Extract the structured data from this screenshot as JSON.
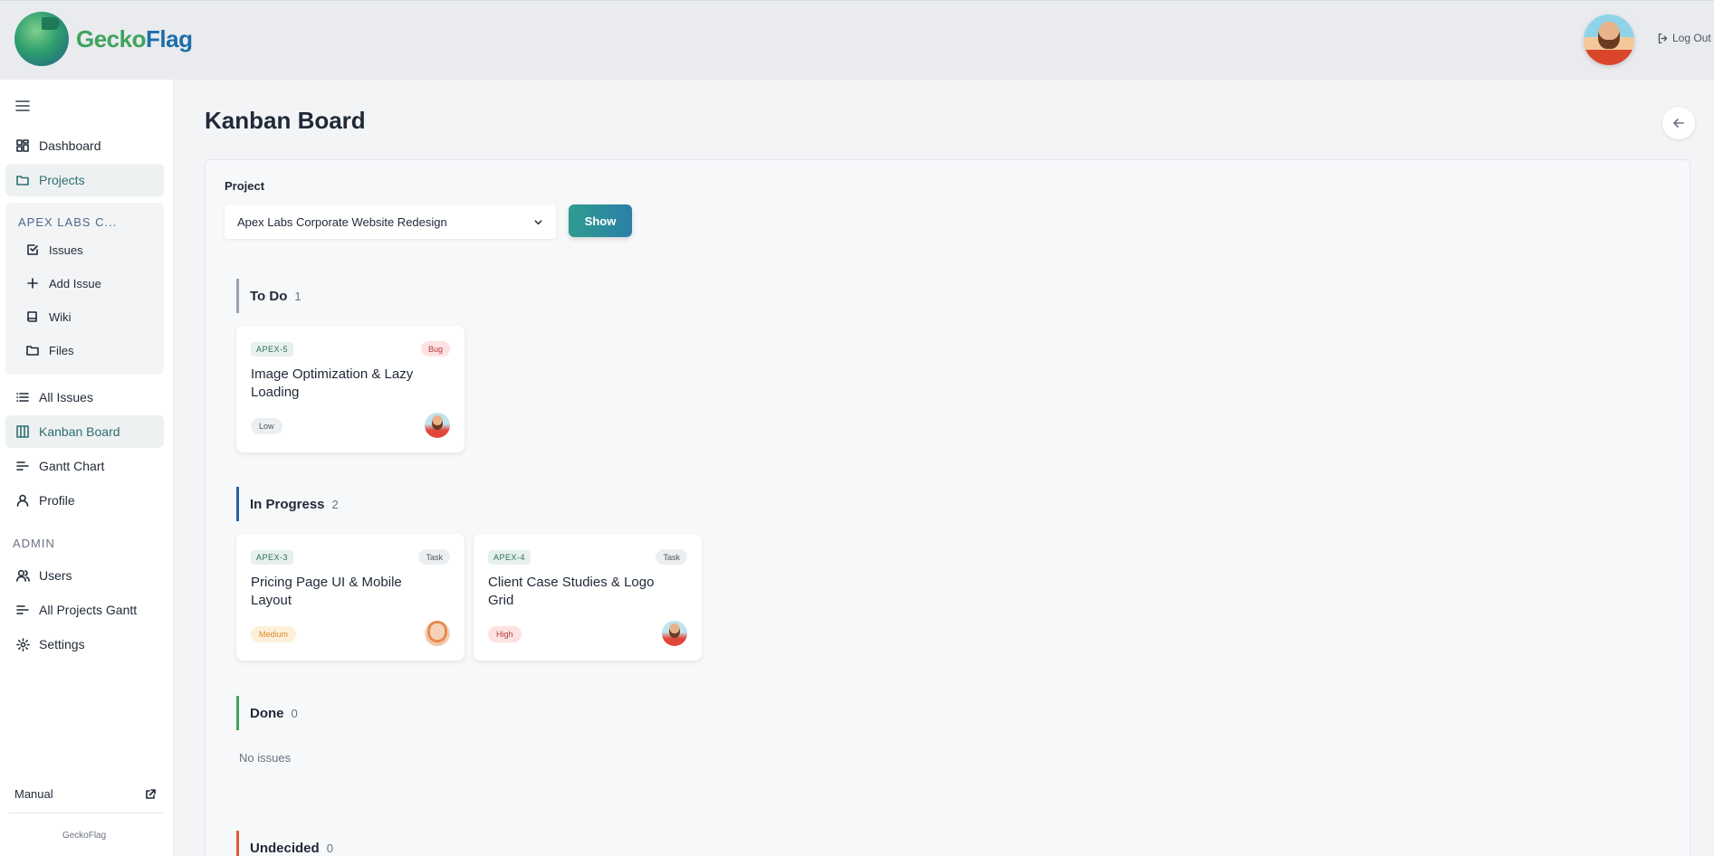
{
  "brand": {
    "name_part1": "Gecko",
    "name_part2": "Flag",
    "accent": "#2f9c8f"
  },
  "header": {
    "logout_label": "Log Out"
  },
  "sidebar": {
    "items_top": [
      {
        "label": "Dashboard",
        "icon": "dashboard-icon"
      },
      {
        "label": "Projects",
        "icon": "folder-icon"
      }
    ],
    "project_menu": {
      "title": "APEX LABS C...",
      "items": [
        {
          "label": "Issues",
          "icon": "check-square-icon"
        },
        {
          "label": "Add Issue",
          "icon": "plus-icon"
        },
        {
          "label": "Wiki",
          "icon": "book-icon"
        },
        {
          "label": "Files",
          "icon": "folder-icon"
        }
      ]
    },
    "items_main": [
      {
        "label": "All Issues",
        "icon": "list-icon"
      },
      {
        "label": "Kanban Board",
        "icon": "kanban-icon"
      },
      {
        "label": "Gantt Chart",
        "icon": "gantt-icon"
      },
      {
        "label": "Profile",
        "icon": "user-icon"
      }
    ],
    "admin_label": "ADMIN",
    "items_admin": [
      {
        "label": "Users",
        "icon": "users-icon"
      },
      {
        "label": "All Projects Gantt",
        "icon": "gantt-icon"
      },
      {
        "label": "Settings",
        "icon": "gear-icon"
      }
    ],
    "manual_label": "Manual",
    "footer": "GeckoFlag"
  },
  "page": {
    "title": "Kanban Board",
    "project_label": "Project",
    "project_selected": "Apex Labs Corporate Website Redesign",
    "show_label": "Show"
  },
  "columns": [
    {
      "name": "To Do",
      "count": "1",
      "color": "#9ca3af",
      "cards": [
        {
          "key": "APEX-5",
          "type": "Bug",
          "title": "Image Optimization & Lazy Loading",
          "priority": "Low"
        }
      ]
    },
    {
      "name": "In Progress",
      "count": "2",
      "color": "#2563a8",
      "cards": [
        {
          "key": "APEX-3",
          "type": "Task",
          "title": "Pricing Page UI & Mobile Layout",
          "priority": "Medium"
        },
        {
          "key": "APEX-4",
          "type": "Task",
          "title": "Client Case Studies & Logo Grid",
          "priority": "High"
        }
      ]
    },
    {
      "name": "Done",
      "count": "0",
      "color": "#3fa35c",
      "empty_text": "No issues"
    },
    {
      "name": "Undecided",
      "count": "0",
      "color": "#e05a3a"
    }
  ]
}
